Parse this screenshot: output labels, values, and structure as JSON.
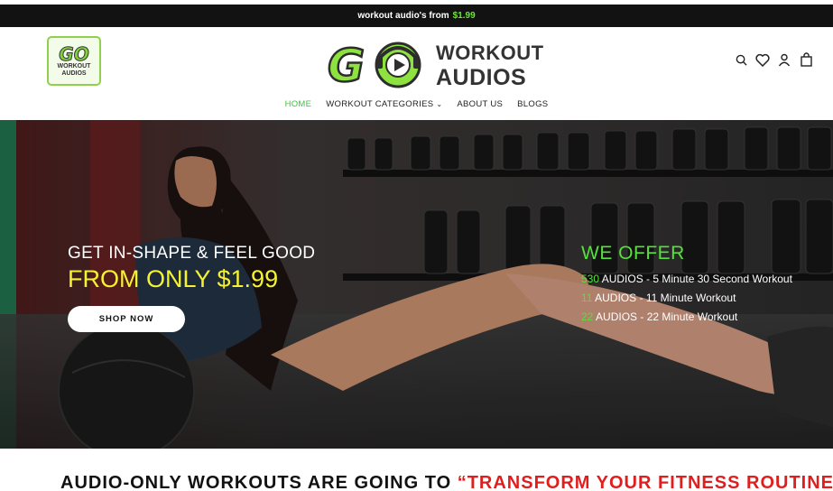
{
  "announcement": {
    "text": "workout audio's from",
    "price": "$1.99"
  },
  "logo": {
    "small": {
      "mark": "GO",
      "line1": "WORKOUT",
      "line2": "AUDIOS"
    },
    "main": {
      "mark": "GO",
      "line1": "WORKOUT",
      "line2": "AUDIOS"
    }
  },
  "header_icons": [
    "search-icon",
    "heart-icon",
    "user-icon",
    "cart-icon"
  ],
  "nav": {
    "items": [
      {
        "label": "HOME",
        "active": true
      },
      {
        "label": "WORKOUT CATEGORIES",
        "dropdown": true
      },
      {
        "label": "ABOUT US"
      },
      {
        "label": "BLOGS"
      }
    ]
  },
  "hero": {
    "headline": "GET IN-SHAPE & FEEL GOOD",
    "subheadline": "FROM ONLY $1.99",
    "cta": "SHOP NOW",
    "offer_title": "WE OFFER",
    "offers": [
      {
        "count": "530",
        "text": "AUDIOS - 5 Minute 30 Second Workout"
      },
      {
        "count": "11",
        "text": "AUDIOS - 11 Minute Workout"
      },
      {
        "count": "22",
        "text": "AUDIOS - 22 Minute Workout"
      }
    ]
  },
  "section": {
    "heading_black": "AUDIO-ONLY WORKOUTS ARE GOING TO",
    "heading_red": "“TRANSFORM YOUR FITNESS ROUTINE"
  },
  "colors": {
    "accent_green": "#55e03c",
    "accent_yellow": "#f4f233",
    "red": "#e01e1e"
  }
}
